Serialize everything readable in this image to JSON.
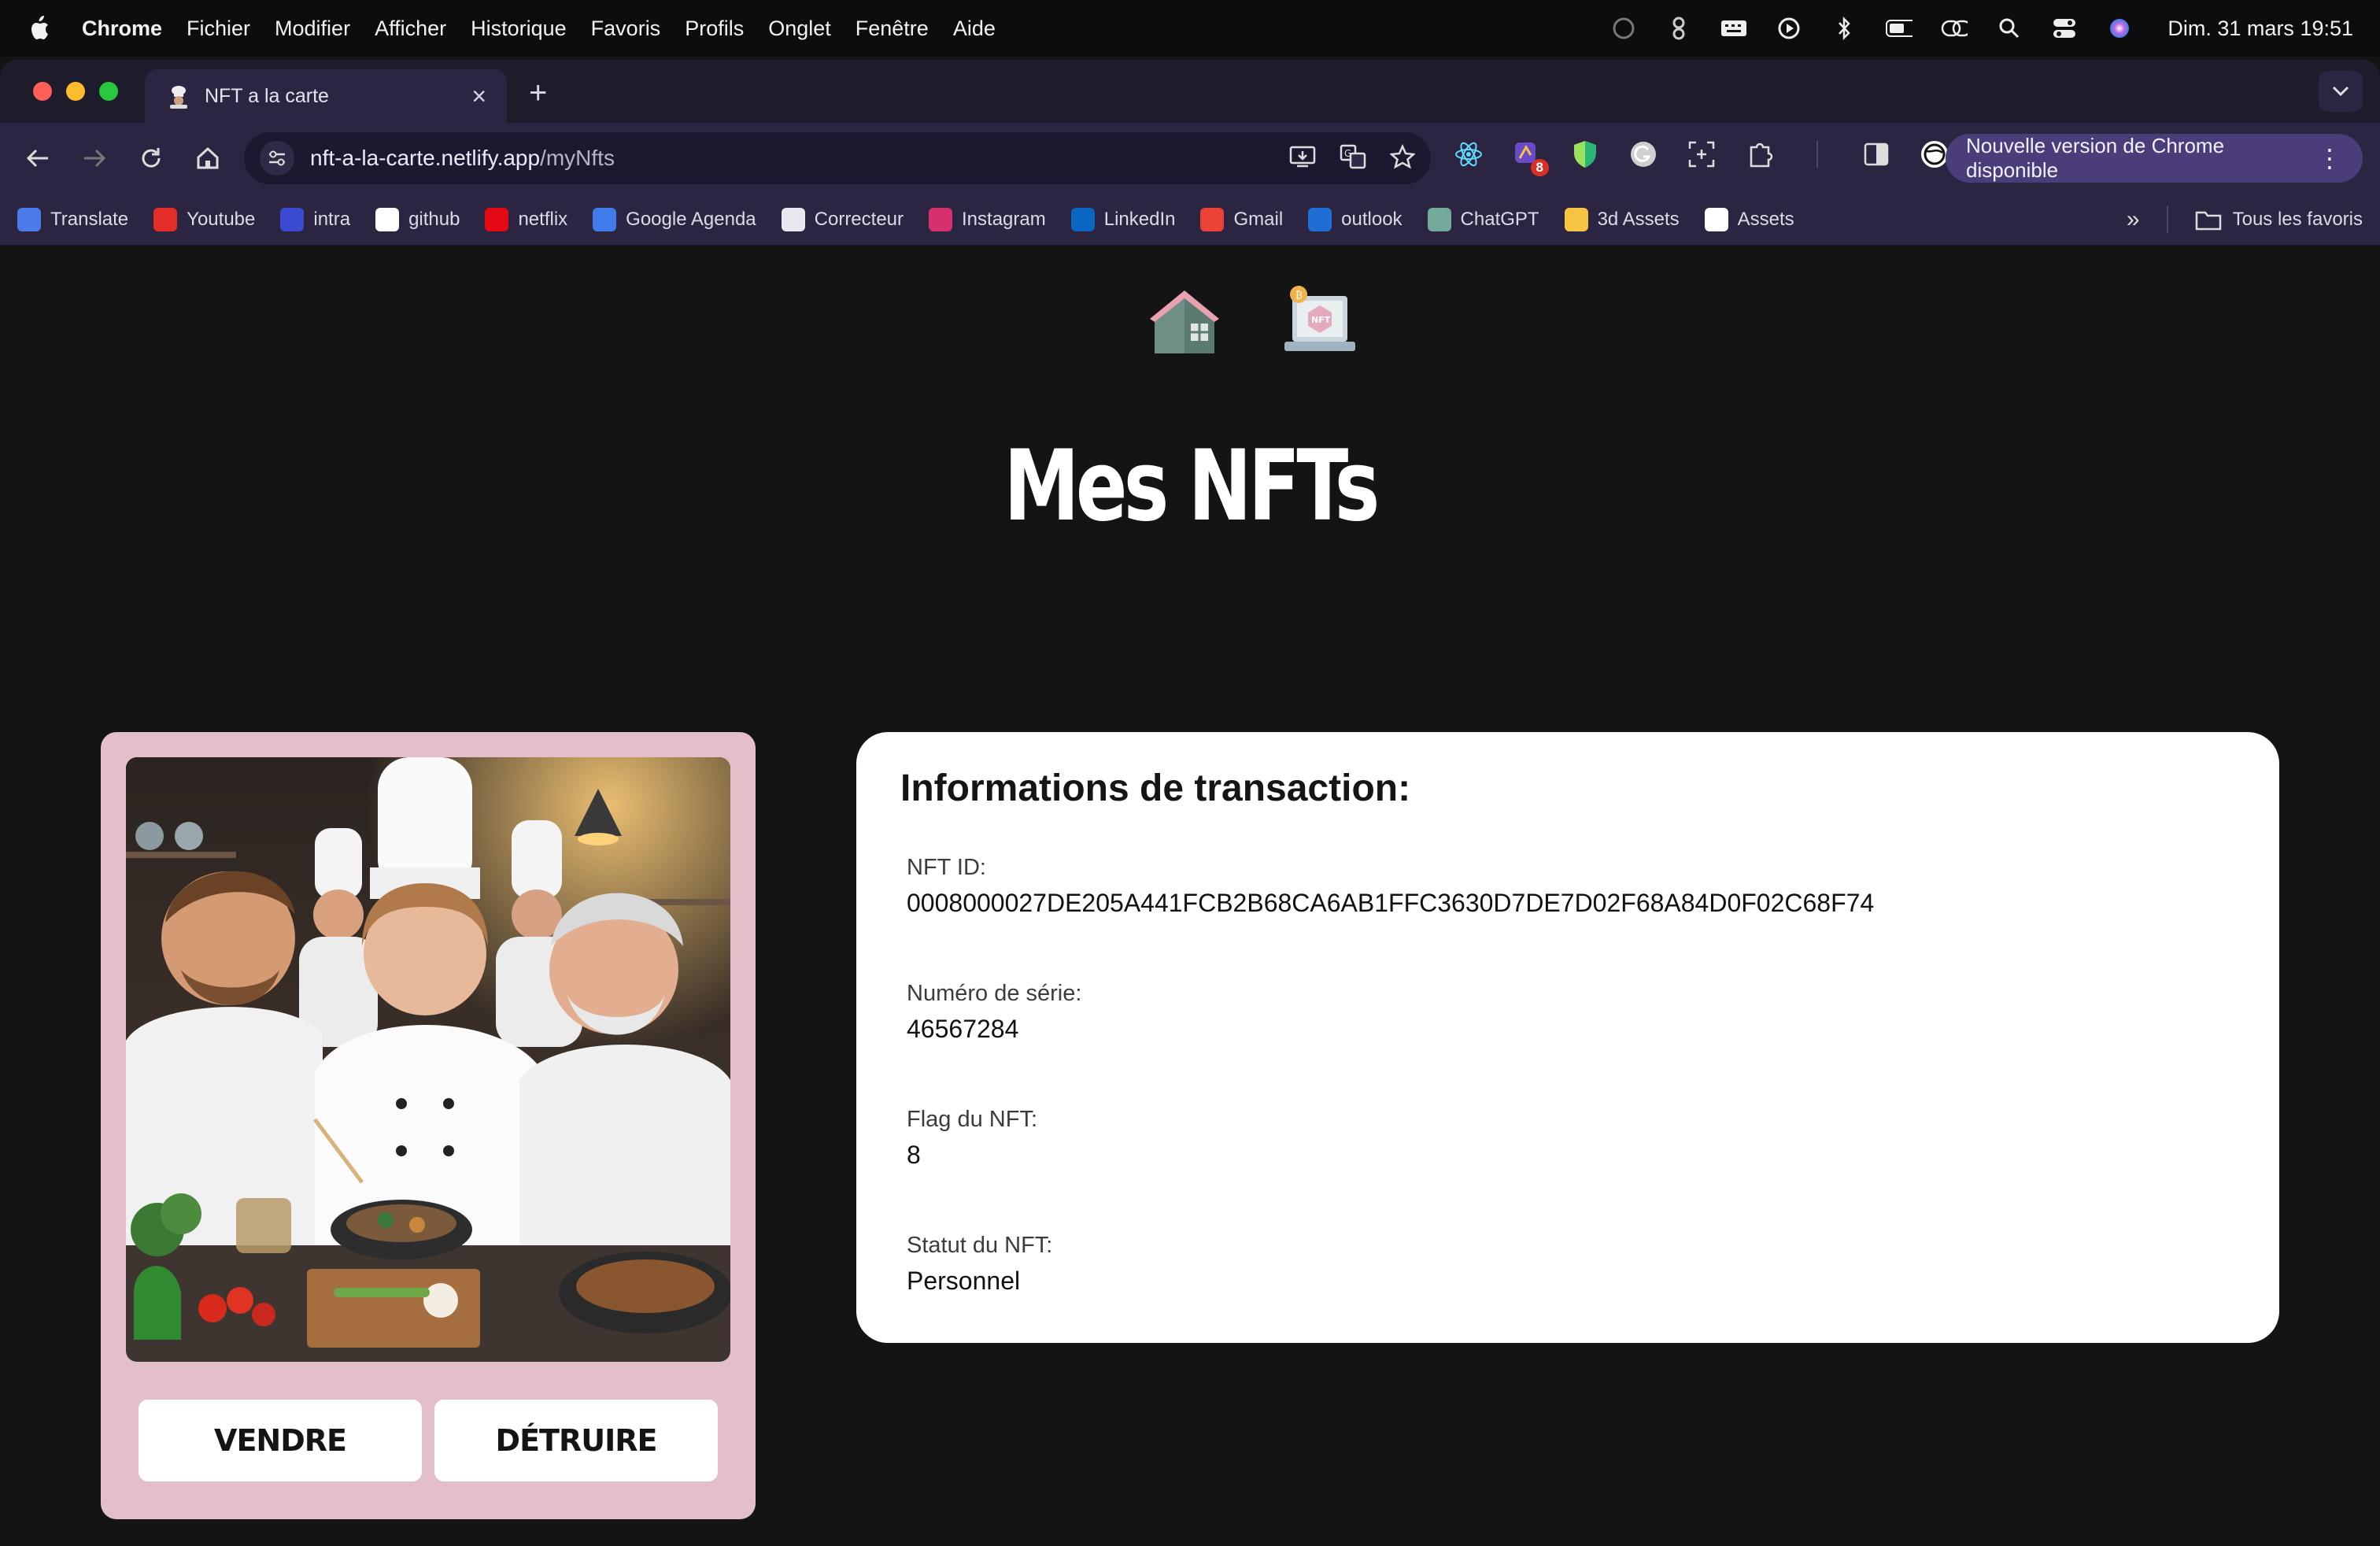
{
  "menubar": {
    "app": "Chrome",
    "items": [
      "Fichier",
      "Modifier",
      "Afficher",
      "Historique",
      "Favoris",
      "Profils",
      "Onglet",
      "Fenêtre",
      "Aide"
    ],
    "clock": "Dim. 31 mars  19:51"
  },
  "browser": {
    "tab_title": "NFT a la carte",
    "url_host": "nft-a-la-carte.netlify.app",
    "url_path": "/myNfts",
    "update_button": "Nouvelle version de Chrome disponible",
    "extension_badge": "8",
    "bookmarks": [
      {
        "label": "Translate",
        "icon": "google-translate-icon",
        "color": "#4a7be8"
      },
      {
        "label": "Youtube",
        "icon": "youtube-icon",
        "color": "#e52d27"
      },
      {
        "label": "intra",
        "icon": "intra-icon",
        "color": "#3b4bd1"
      },
      {
        "label": "github",
        "icon": "github-icon",
        "color": "#ffffff"
      },
      {
        "label": "netflix",
        "icon": "netflix-icon",
        "color": "#e50914"
      },
      {
        "label": "Google Agenda",
        "icon": "calendar-icon",
        "color": "#3f7bea"
      },
      {
        "label": "Correcteur",
        "icon": "correcteur-icon",
        "color": "#e8e8f0"
      },
      {
        "label": "Instagram",
        "icon": "instagram-icon",
        "color": "#d6306f"
      },
      {
        "label": "LinkedIn",
        "icon": "linkedin-icon",
        "color": "#0a66c2"
      },
      {
        "label": "Gmail",
        "icon": "gmail-icon",
        "color": "#ea4335"
      },
      {
        "label": "outlook",
        "icon": "outlook-icon",
        "color": "#1f6ed4"
      },
      {
        "label": "ChatGPT",
        "icon": "chatgpt-icon",
        "color": "#74aa9c"
      },
      {
        "label": "3d Assets",
        "icon": "3d-assets-icon",
        "color": "#f6c342"
      },
      {
        "label": "Assets",
        "icon": "assets-icon",
        "color": "#ffffff"
      }
    ],
    "all_bookmarks": "Tous les favoris"
  },
  "page": {
    "title": "Mes NFTs",
    "nav": {
      "home_icon": "house-icon",
      "nft_icon": "nft-laptop-icon"
    },
    "card": {
      "sell_label": "VENDRE",
      "burn_label": "DÉTRUIRE",
      "bg_color": "#e4bec8"
    },
    "info": {
      "heading": "Informations de transaction:",
      "fields": [
        {
          "label": "NFT ID:",
          "value": "0008000027DE205A441FCB2B68CA6AB1FFC3630D7DE7D02F68A84D0F02C68F74"
        },
        {
          "label": "Numéro de série:",
          "value": "46567284"
        },
        {
          "label": "Flag du NFT:",
          "value": "8"
        },
        {
          "label": "Statut du NFT:",
          "value": "Personnel"
        }
      ]
    }
  }
}
